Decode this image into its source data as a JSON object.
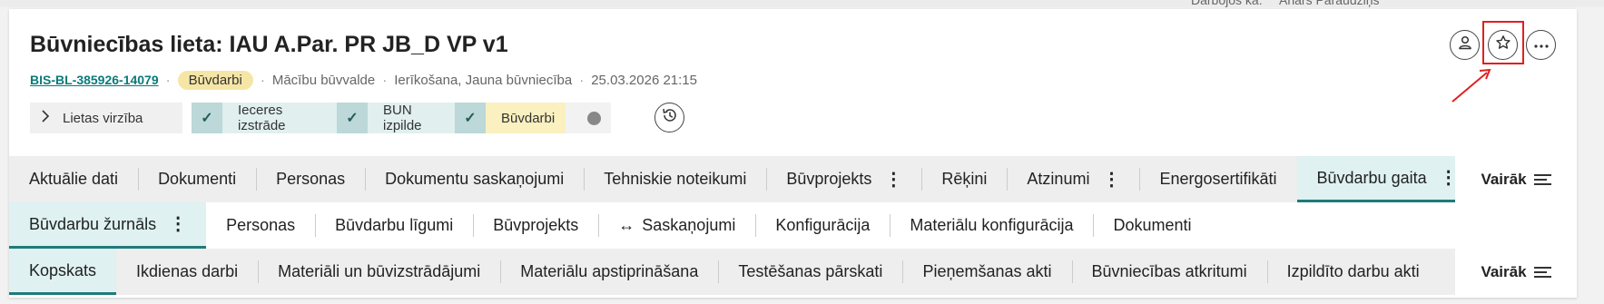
{
  "header": {
    "top_working_as": "Darbojos kā:",
    "top_user": "Anārs Paraudziņš",
    "title": "Būvniecības lieta: IAU A.Par. PR JB_D VP v1",
    "case_id": "BIS-BL-385926-14079",
    "status_badge": "Būvdarbi",
    "authority": "Mācību būvvalde",
    "case_type": "Ierīkošana, Jauna būvniecība",
    "datetime": "25.03.2026 21:15"
  },
  "stepper": {
    "toggle_label": "Lietas virzība",
    "steps": [
      {
        "label": "Ieceres izstrāde",
        "done": true
      },
      {
        "label": "BUN izpilde",
        "done": true
      },
      {
        "label": "Būvdarbi",
        "done": true,
        "current": true
      }
    ]
  },
  "main_tabs": {
    "items": [
      {
        "label": "Aktuālie dati"
      },
      {
        "label": "Dokumenti"
      },
      {
        "label": "Personas"
      },
      {
        "label": "Dokumentu saskaņojumi"
      },
      {
        "label": "Tehniskie noteikumi"
      },
      {
        "label": "Būvprojekts"
      },
      {
        "label": "Rēķini"
      },
      {
        "label": "Atzinumi"
      },
      {
        "label": "Energosertifikāti"
      },
      {
        "label": "Būvdarbu gaita"
      }
    ],
    "more_label": "Vairāk"
  },
  "sub_tabs": {
    "items": [
      {
        "label": "Būvdarbu žurnāls"
      },
      {
        "label": "Personas"
      },
      {
        "label": "Būvdarbu līgumi"
      },
      {
        "label": "Būvprojekts"
      },
      {
        "label": "Saskaņojumi"
      },
      {
        "label": "Konfigurācija"
      },
      {
        "label": "Materiālu konfigurācija"
      },
      {
        "label": "Dokumenti"
      }
    ]
  },
  "third_tabs": {
    "items": [
      {
        "label": "Kopskats"
      },
      {
        "label": "Ikdienas darbi"
      },
      {
        "label": "Materiāli un būvizstrādājumi"
      },
      {
        "label": "Materiālu apstiprināšana"
      },
      {
        "label": "Testēšanas pārskati"
      },
      {
        "label": "Pieņemšanas akti"
      },
      {
        "label": "Būvniecības atkritumi"
      },
      {
        "label": "Izpildīto darbu akti"
      }
    ],
    "more_label": "Vairāk"
  },
  "colors": {
    "accent": "#1f7a7a",
    "badge": "#f6e6a6",
    "highlight": "#e02020"
  },
  "icons": {
    "user": "user-icon",
    "favorite": "star-icon",
    "more": "ellipsis-icon",
    "history": "history-icon"
  }
}
